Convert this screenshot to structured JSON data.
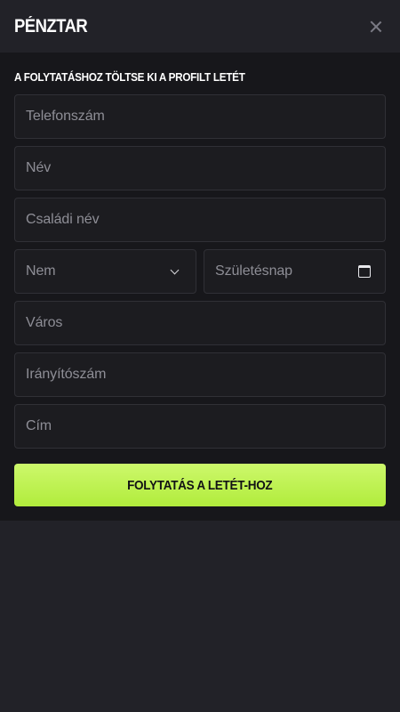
{
  "header": {
    "title": "PÉNZTAR"
  },
  "form": {
    "subtitle": "A FOLYTATÁSHOZ TÖLTSE KI A PROFILT LETÉT",
    "phone_placeholder": "Telefonszám",
    "name_placeholder": "Név",
    "family_name_placeholder": "Családi név",
    "gender_select": "Nem",
    "birthday_placeholder": "Születésnap",
    "city_placeholder": "Város",
    "zip_placeholder": "Irányítószám",
    "address_placeholder": "Cím",
    "submit_label": "FOLYTATÁS A LETÉT-HOZ"
  },
  "colors": {
    "background": "#222228",
    "panel": "#17171b",
    "field_bg": "#1c1c20",
    "field_border": "#303036",
    "accent": "#b9f14a"
  },
  "icons": {
    "close": "close-icon",
    "select": "chevron-down-icon",
    "date": "calendar-icon"
  }
}
